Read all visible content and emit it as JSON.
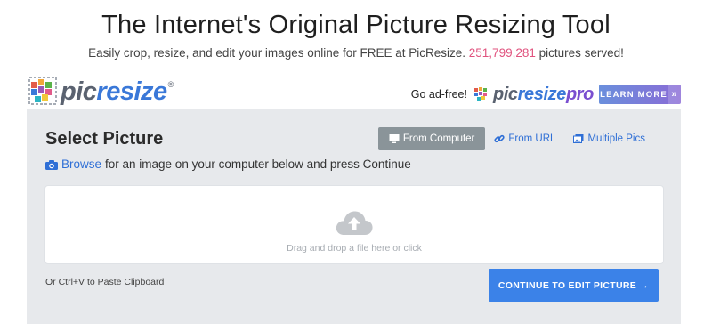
{
  "hero": {
    "title": "The Internet's Original Picture Resizing Tool",
    "subtitle_pre": "Easily crop, resize, and edit your images online for FREE at PicResize. ",
    "count": "251,799,281",
    "subtitle_post": " pictures served!"
  },
  "brand": {
    "logo_pic": "pic",
    "logo_resize": "resize",
    "logo_reg": "®",
    "go_adfree": "Go ad-free!",
    "pro_pic": "pic",
    "pro_resize": "resize",
    "pro_pro": "pro",
    "learn_more": "LEARN MORE",
    "learn_more_chevron": "»"
  },
  "panel": {
    "title": "Select Picture",
    "browse_link": "Browse",
    "browse_rest": "for an image on your computer below and press Continue",
    "tabs": [
      {
        "label": "From Computer",
        "icon": "monitor-icon",
        "active": true
      },
      {
        "label": "From URL",
        "icon": "link-icon",
        "active": false
      },
      {
        "label": "Multiple Pics",
        "icon": "images-icon",
        "active": false
      }
    ],
    "drop_text": "Drag and drop a file here or click",
    "paste_hint": "Or Ctrl+V to Paste Clipboard",
    "continue_label": "CONTINUE TO EDIT PICTURE →"
  },
  "colors": {
    "accent_blue": "#3b82e8",
    "count_pink": "#e0527e",
    "panel_bg": "#e7e9ec",
    "active_tab": "#8a9499"
  }
}
